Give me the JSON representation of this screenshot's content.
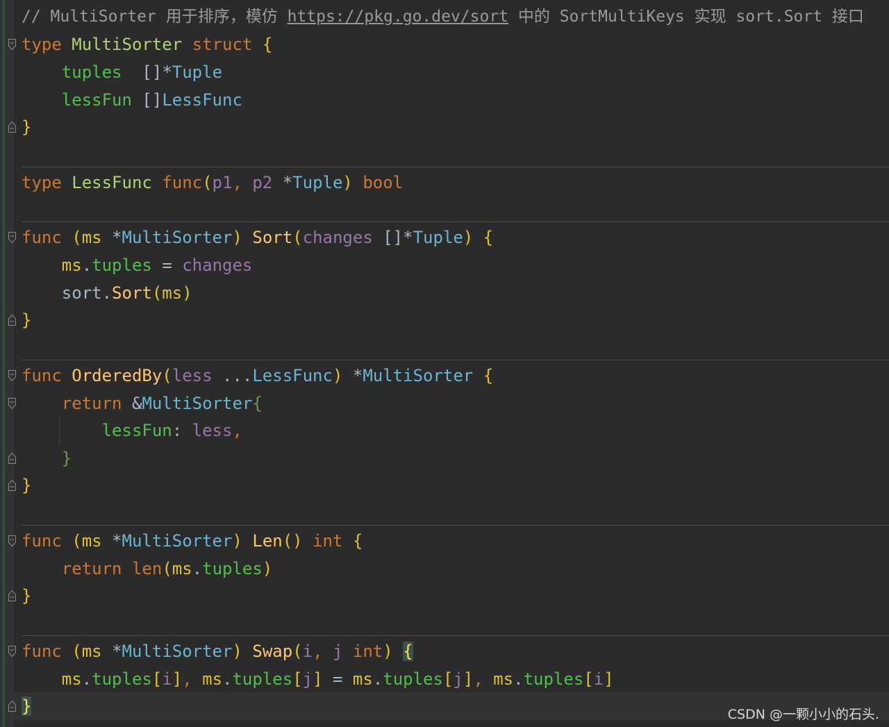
{
  "editor": {
    "language": "go",
    "colors": {
      "background": "#2b2b2b",
      "gutter": "#313335",
      "keyword": "#cc7832",
      "type": "#6ab5d2",
      "field": "#4fc14b",
      "param": "#9876aa",
      "receiver": "#e2c22d",
      "function": "#ffc66d",
      "comment": "#9a9a9a"
    }
  },
  "code": {
    "l1": {
      "comment_a": "// MultiSorter 用于排序，模仿 ",
      "link": "https://pkg.go.dev/sort",
      "comment_b": " 中的 SortMultiKeys 实现 sort.Sort 接口"
    },
    "l2": {
      "kw": "type",
      "name": "MultiSorter",
      "kw2": "struct",
      "brace": "{"
    },
    "l3": {
      "field": "tuples",
      "bracket": "[]",
      "star": "*",
      "type": "Tuple"
    },
    "l4": {
      "field": "lessFun",
      "bracket": "[]",
      "type": "LessFunc"
    },
    "l5": {
      "brace": "}"
    },
    "l6": {
      "kw": "type",
      "name": "LessFunc",
      "kw2": "func",
      "open": "(",
      "p1": "p1",
      "comma": ",",
      "p2": "p2",
      "star": "*",
      "type": "Tuple",
      "close": ")",
      "ret": "bool"
    },
    "l7": {
      "kw": "func",
      "open": "(",
      "recv": "ms",
      "star": "*",
      "type": "MultiSorter",
      "close": ")",
      "fn": "Sort",
      "popen": "(",
      "param": "changes",
      "bracket": "[]",
      "star2": "*",
      "ptype": "Tuple",
      "pclose": ")",
      "brace": "{"
    },
    "l8": {
      "recv": "ms",
      "dot": ".",
      "field": "tuples",
      "eq": "=",
      "param": "changes"
    },
    "l9": {
      "pkg": "sort",
      "dot": ".",
      "fn": "Sort",
      "open": "(",
      "recv": "ms",
      "close": ")"
    },
    "l10": {
      "brace": "}"
    },
    "l11": {
      "kw": "func",
      "fn": "OrderedBy",
      "open": "(",
      "param": "less",
      "dots": "...",
      "type": "LessFunc",
      "close": ")",
      "star": "*",
      "rtype": "MultiSorter",
      "brace": "{"
    },
    "l12": {
      "kw": "return",
      "amp": "&",
      "type": "MultiSorter",
      "brace": "{"
    },
    "l13": {
      "field": "lessFun",
      "colon": ":",
      "param": "less",
      "comma": ","
    },
    "l14": {
      "brace": "}"
    },
    "l15": {
      "brace": "}"
    },
    "l16": {
      "kw": "func",
      "open": "(",
      "recv": "ms",
      "star": "*",
      "type": "MultiSorter",
      "close": ")",
      "fn": "Len",
      "parens": "()",
      "ret": "int",
      "brace": "{"
    },
    "l17": {
      "kw": "return",
      "fn": "len",
      "open": "(",
      "recv": "ms",
      "dot": ".",
      "field": "tuples",
      "close": ")"
    },
    "l18": {
      "brace": "}"
    },
    "l19": {
      "kw": "func",
      "open": "(",
      "recv": "ms",
      "star": "*",
      "type": "MultiSorter",
      "close": ")",
      "fn": "Swap",
      "popen": "(",
      "p1": "i",
      "comma": ",",
      "p2": "j",
      "ptype": "int",
      "pclose": ")",
      "brace": "{"
    },
    "l20": {
      "recv": "ms",
      "dot": ".",
      "field": "tuples",
      "open": "[",
      "i": "i",
      "close": "]",
      "comma": ",",
      "j": "j",
      "eq": "="
    },
    "l21": {
      "brace": "}"
    }
  },
  "watermark": "CSDN @一颗小小的石头."
}
